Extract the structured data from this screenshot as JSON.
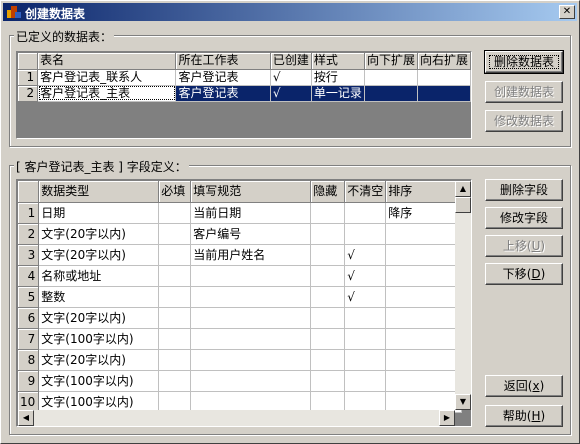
{
  "window": {
    "title": "创建数据表"
  },
  "defined_tables": {
    "group_label": "已定义的数据表：",
    "columns": [
      "",
      "表名",
      "所在工作表",
      "已创建",
      "样式",
      "向下扩展",
      "向右扩展"
    ],
    "rows": [
      {
        "num": "1",
        "name": "客户登记表_联系人",
        "sheet": "客户登记表",
        "created": "√",
        "style": "按行",
        "down": "",
        "right": ""
      },
      {
        "num": "2",
        "name": "客户登记表_主表",
        "sheet": "客户登记表",
        "created": "√",
        "style": "单一记录",
        "down": "",
        "right": ""
      }
    ],
    "selected_row": 2,
    "buttons": {
      "delete": "删除数据表",
      "create": "创建数据表",
      "modify": "修改数据表"
    }
  },
  "field_def": {
    "group_label": "[ 客户登记表_主表 ] 字段定义：",
    "columns": [
      "",
      "数据类型",
      "必填",
      "填写规范",
      "隐藏",
      "不清空",
      "排序"
    ],
    "rows": [
      {
        "num": "1",
        "type": "日期",
        "required": "",
        "spec": "当前日期",
        "hidden": "",
        "noclear": "",
        "sort": "降序"
      },
      {
        "num": "2",
        "type": "文字(20字以内)",
        "required": "",
        "spec": "客户编号",
        "hidden": "",
        "noclear": "",
        "sort": ""
      },
      {
        "num": "3",
        "type": "文字(20字以内)",
        "required": "",
        "spec": "当前用户姓名",
        "hidden": "",
        "noclear": "√",
        "sort": ""
      },
      {
        "num": "4",
        "type": "名称或地址",
        "required": "",
        "spec": "",
        "hidden": "",
        "noclear": "√",
        "sort": ""
      },
      {
        "num": "5",
        "type": "整数",
        "required": "",
        "spec": "",
        "hidden": "",
        "noclear": "√",
        "sort": ""
      },
      {
        "num": "6",
        "type": "文字(20字以内)",
        "required": "",
        "spec": "",
        "hidden": "",
        "noclear": "",
        "sort": ""
      },
      {
        "num": "7",
        "type": "文字(100字以内)",
        "required": "",
        "spec": "",
        "hidden": "",
        "noclear": "",
        "sort": ""
      },
      {
        "num": "8",
        "type": "文字(20字以内)",
        "required": "",
        "spec": "",
        "hidden": "",
        "noclear": "",
        "sort": ""
      },
      {
        "num": "9",
        "type": "文字(100字以内)",
        "required": "",
        "spec": "",
        "hidden": "",
        "noclear": "",
        "sort": ""
      },
      {
        "num": "10",
        "type": "文字(100字以内)",
        "required": "",
        "spec": "",
        "hidden": "",
        "noclear": "",
        "sort": ""
      }
    ],
    "buttons": {
      "delete_field": "删除字段",
      "modify_field": "修改字段",
      "move_up": "上移",
      "move_up_key": "U",
      "move_down": "下移",
      "move_down_key": "D",
      "back": "返回",
      "back_key": "x",
      "help": "帮助",
      "help_key": "H"
    }
  },
  "icons": {
    "app": "app-icon",
    "close": "close-icon"
  }
}
